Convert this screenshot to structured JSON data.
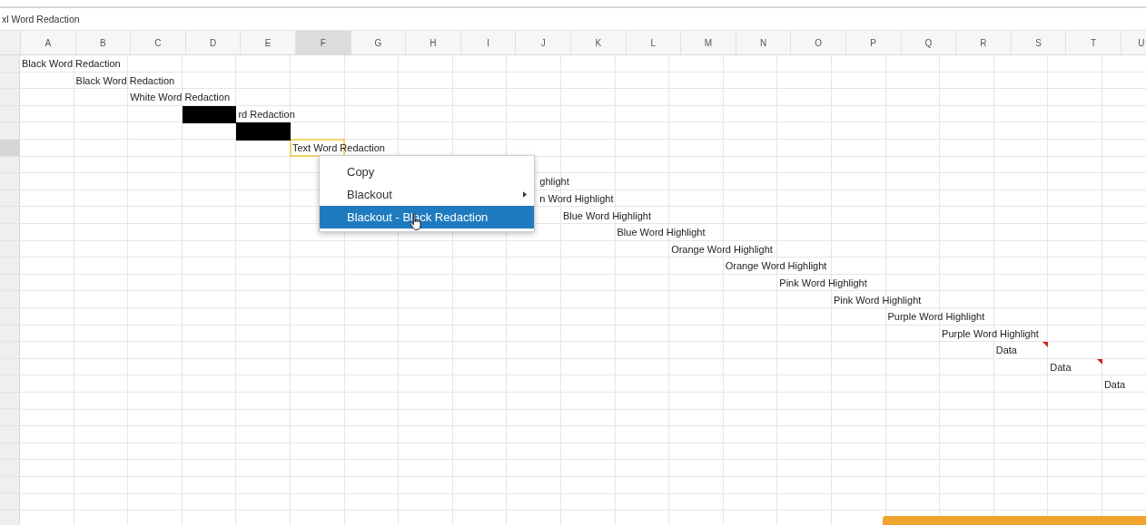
{
  "document": {
    "title": "xl Word Redaction"
  },
  "columns": [
    {
      "label": "A",
      "selected": false
    },
    {
      "label": "B",
      "selected": false
    },
    {
      "label": "C",
      "selected": false
    },
    {
      "label": "D",
      "selected": false
    },
    {
      "label": "E",
      "selected": false
    },
    {
      "label": "F",
      "selected": true
    },
    {
      "label": "G",
      "selected": false
    },
    {
      "label": "H",
      "selected": false
    },
    {
      "label": "I",
      "selected": false
    },
    {
      "label": "J",
      "selected": false
    },
    {
      "label": "K",
      "selected": false
    },
    {
      "label": "L",
      "selected": false
    },
    {
      "label": "M",
      "selected": false
    },
    {
      "label": "N",
      "selected": false
    },
    {
      "label": "O",
      "selected": false
    },
    {
      "label": "P",
      "selected": false
    },
    {
      "label": "Q",
      "selected": false
    },
    {
      "label": "R",
      "selected": false
    },
    {
      "label": "S",
      "selected": false
    },
    {
      "label": "T",
      "selected": false
    },
    {
      "label": "U",
      "selected": false
    }
  ],
  "rows": [
    {
      "selected": false,
      "cells": [
        {
          "text": "Black Word Redaction",
          "selected": false
        }
      ]
    },
    {
      "selected": false,
      "cells": [
        {},
        {
          "text": "Black Word Redaction",
          "selected": false
        }
      ]
    },
    {
      "selected": false,
      "cells": [
        {},
        {},
        {
          "text": "White Word Redaction",
          "selected": false
        }
      ]
    },
    {
      "selected": false,
      "cells": [
        {},
        {},
        {},
        {
          "redacted": true
        },
        {
          "text": "rd Redaction",
          "selected": false
        }
      ]
    },
    {
      "selected": false,
      "cells": [
        {},
        {},
        {},
        {},
        {
          "redacted": true
        }
      ]
    },
    {
      "selected": true,
      "cells": [
        {},
        {},
        {},
        {},
        {},
        {
          "text": "Text Word Redaction",
          "selected": true
        }
      ]
    },
    {
      "selected": false
    },
    {
      "selected": false,
      "cells": [
        {},
        {},
        {},
        {},
        {},
        {},
        {},
        {},
        {},
        {
          "text": "ghlight",
          "selected": false,
          "partly_hidden": true
        }
      ]
    },
    {
      "selected": false,
      "cells": [
        {},
        {},
        {},
        {},
        {},
        {},
        {},
        {},
        {},
        {
          "text": "n Word Highlight",
          "selected": false,
          "partly_hidden": true
        }
      ]
    },
    {
      "selected": false,
      "cells": [
        {},
        {},
        {},
        {},
        {},
        {},
        {},
        {},
        {},
        {},
        {
          "text": "Blue Word Highlight",
          "selected": false
        }
      ]
    },
    {
      "selected": false,
      "cells": [
        {},
        {},
        {},
        {},
        {},
        {},
        {},
        {},
        {},
        {},
        {},
        {
          "text": "Blue Word Highlight",
          "selected": false
        }
      ]
    },
    {
      "selected": false,
      "cells": [
        {},
        {},
        {},
        {},
        {},
        {},
        {},
        {},
        {},
        {},
        {},
        {},
        {
          "text": "Orange Word Highlight",
          "selected": false
        }
      ]
    },
    {
      "selected": false,
      "cells": [
        {},
        {},
        {},
        {},
        {},
        {},
        {},
        {},
        {},
        {},
        {},
        {},
        {},
        {
          "text": "Orange Word Highlight",
          "selected": false
        }
      ]
    },
    {
      "selected": false,
      "cells": [
        {},
        {},
        {},
        {},
        {},
        {},
        {},
        {},
        {},
        {},
        {},
        {},
        {},
        {},
        {
          "text": "Pink Word Highlight",
          "selected": false
        }
      ]
    },
    {
      "selected": false,
      "cells": [
        {},
        {},
        {},
        {},
        {},
        {},
        {},
        {},
        {},
        {},
        {},
        {},
        {},
        {},
        {},
        {
          "text": "Pink Word Highlight",
          "selected": false
        }
      ]
    },
    {
      "selected": false,
      "cells": [
        {},
        {},
        {},
        {},
        {},
        {},
        {},
        {},
        {},
        {},
        {},
        {},
        {},
        {},
        {},
        {},
        {
          "text": "Purple Word Highlight",
          "selected": false
        }
      ]
    },
    {
      "selected": false,
      "cells": [
        {},
        {},
        {},
        {},
        {},
        {},
        {},
        {},
        {},
        {},
        {},
        {},
        {},
        {},
        {},
        {},
        {},
        {
          "text": "Purple Word Highlight",
          "selected": false
        }
      ]
    },
    {
      "selected": false,
      "cells": [
        {},
        {},
        {},
        {},
        {},
        {},
        {},
        {},
        {},
        {},
        {},
        {},
        {},
        {},
        {},
        {},
        {},
        {},
        {
          "text": "Data",
          "selected": false,
          "comment": true
        }
      ]
    },
    {
      "selected": false,
      "cells": [
        {},
        {},
        {},
        {},
        {},
        {},
        {},
        {},
        {},
        {},
        {},
        {},
        {},
        {},
        {},
        {},
        {},
        {},
        {},
        {
          "text": "Data",
          "selected": false,
          "comment": true
        }
      ]
    },
    {
      "selected": false,
      "cells": [
        {},
        {},
        {},
        {},
        {},
        {},
        {},
        {},
        {},
        {},
        {},
        {},
        {},
        {},
        {},
        {},
        {},
        {},
        {},
        {},
        {
          "text": "Data",
          "selected": false
        }
      ]
    },
    {
      "selected": false
    },
    {
      "selected": false
    },
    {
      "selected": false
    },
    {
      "selected": false
    },
    {
      "selected": false
    },
    {
      "selected": false
    },
    {
      "selected": false
    },
    {
      "selected": false
    }
  ],
  "context_menu": {
    "items": [
      {
        "label": "Copy",
        "kind": "item",
        "selected": false
      },
      {
        "label": "Blackout",
        "kind": "submenu",
        "selected": false
      },
      {
        "label": "Blackout - Black Redaction",
        "kind": "item",
        "selected": true
      }
    ]
  },
  "notification": {
    "kind": "banner"
  }
}
